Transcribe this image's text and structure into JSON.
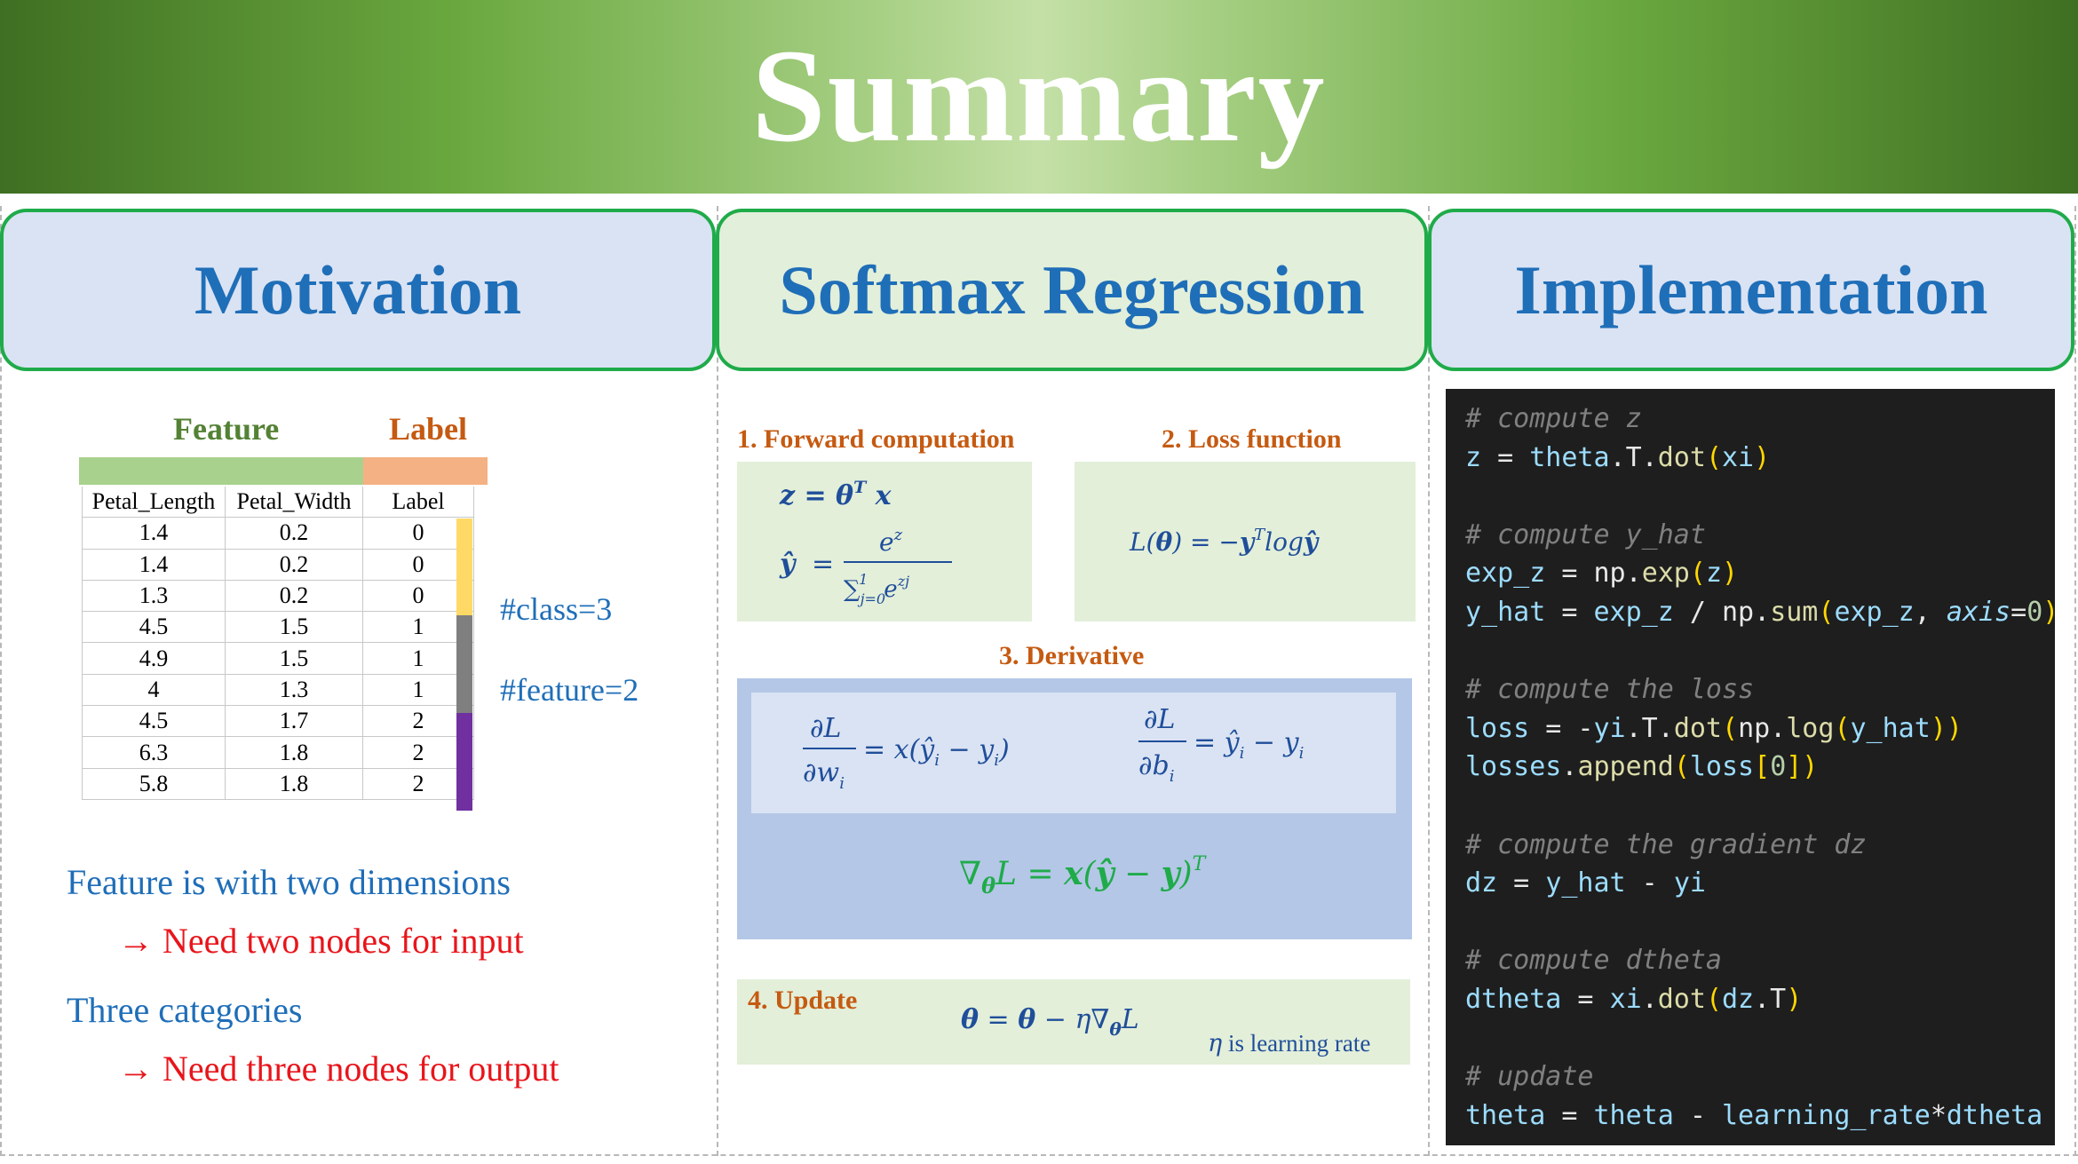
{
  "title": "Summary",
  "headers": {
    "motivation": "Motivation",
    "softmax": "Softmax Regression",
    "implementation": "Implementation"
  },
  "motivation": {
    "feature_label": "Feature",
    "label_label": "Label",
    "columns": [
      "Petal_Length",
      "Petal_Width",
      "Label"
    ],
    "rows": [
      [
        "1.4",
        "0.2",
        "0"
      ],
      [
        "1.4",
        "0.2",
        "0"
      ],
      [
        "1.3",
        "0.2",
        "0"
      ],
      [
        "4.5",
        "1.5",
        "1"
      ],
      [
        "4.9",
        "1.5",
        "1"
      ],
      [
        "4",
        "1.3",
        "1"
      ],
      [
        "4.5",
        "1.7",
        "2"
      ],
      [
        "6.3",
        "1.8",
        "2"
      ],
      [
        "5.8",
        "1.8",
        "2"
      ]
    ],
    "class_count": "#class=3",
    "feature_count": "#feature=2",
    "line1": "Feature is with two dimensions",
    "line2": "Need two nodes for input",
    "line3": "Three categories",
    "line4": "Need three nodes for output",
    "arrow": "→",
    "colors": {
      "feature_bar": "#a9d18e",
      "label_bar": "#f4b183",
      "class0": "#ffd966",
      "class1": "#7f7f7f",
      "class2": "#7030a0"
    }
  },
  "softmax": {
    "forward_title": "1. Forward computation",
    "loss_title": "2. Loss function",
    "derivative_title": "3. Derivative",
    "update_title": "4. Update",
    "eta_note": "is learning rate",
    "eta_symbol": "η"
  },
  "code": [
    "# compute z",
    "z = theta.T.dot(xi)",
    "",
    "# compute y_hat",
    "exp_z = np.exp(z)",
    "y_hat = exp_z / np.sum(exp_z, axis=0)",
    "",
    "# compute the loss",
    "loss = -yi.T.dot(np.log(y_hat))",
    "losses.append(loss[0])",
    "",
    "# compute the gradient dz",
    "dz = y_hat - yi",
    "",
    "# compute dtheta",
    "dtheta = xi.dot(dz.T)",
    "",
    "# update",
    "theta = theta - learning_rate*dtheta"
  ]
}
